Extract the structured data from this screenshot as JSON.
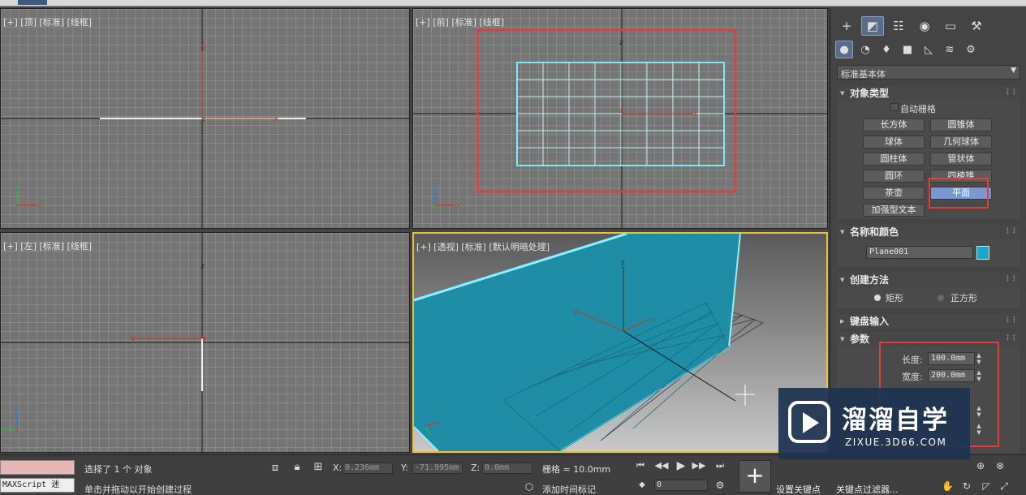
{
  "viewports": {
    "top": {
      "label": "[+] [顶] [标准] [线框]"
    },
    "front": {
      "label": "[+] [前] [标准] [线框]"
    },
    "left": {
      "label": "[+] [左] [标准] [线框]"
    },
    "perspective": {
      "label": "[+] [透视] [标准] [默认明暗处理]"
    }
  },
  "command_panel": {
    "main_tabs": [
      "create-icon",
      "modify-icon",
      "hierarchy-icon",
      "motion-icon",
      "display-icon",
      "utilities-icon"
    ],
    "sub_tabs": [
      "geometry-icon",
      "shapes-icon",
      "lights-icon",
      "cameras-icon",
      "helpers-icon",
      "space-warps-icon",
      "systems-icon"
    ],
    "category_dropdown": "标准基本体",
    "object_type": {
      "title": "对象类型",
      "autogrid": "自动栅格",
      "buttons": [
        "长方体",
        "圆锥体",
        "球体",
        "几何球体",
        "圆柱体",
        "管状体",
        "圆环",
        "四棱锥",
        "茶壶",
        "平面",
        "加强型文本"
      ],
      "selected": "平面"
    },
    "name_color": {
      "title": "名称和颜色",
      "name": "Plane001",
      "color": "#1aa6c6"
    },
    "creation_method": {
      "title": "创建方法",
      "options": [
        "矩形",
        "正方形"
      ],
      "selected": "矩形"
    },
    "keyboard_entry": {
      "title": "键盘输入"
    },
    "parameters": {
      "title": "参数",
      "length_label": "长度:",
      "length_value": "100.0mm",
      "width_label": "宽度:",
      "width_value": "200.0mm"
    }
  },
  "status_bar": {
    "script_label": "MAXScript 迷",
    "status_line1": "选择了 1 个 对象",
    "status_line2": "单击并拖动以开始创建过程",
    "x_label": "X:",
    "x_value": "0.236mm",
    "y_label": "Y:",
    "y_value": "-71.995mm",
    "z_label": "Z:",
    "z_value": "0.0mm",
    "grid": "栅格 = 10.0mm",
    "add_time_tag": "添加时间标记",
    "frame_value": "0",
    "set_key": "设置关键点",
    "key_filters": "关键点过滤器..."
  },
  "watermark": {
    "title": "溜溜自学",
    "url": "ZIXUE.3D66.COM"
  }
}
